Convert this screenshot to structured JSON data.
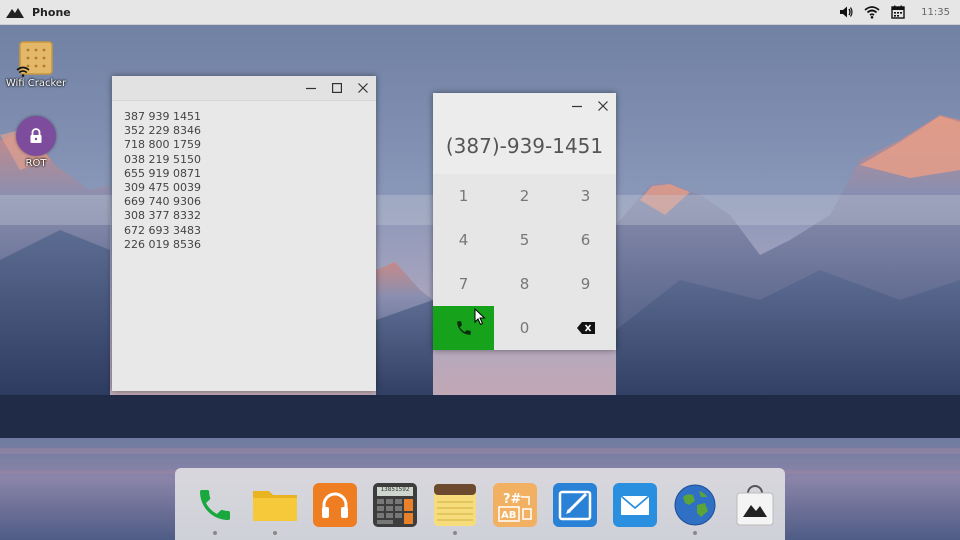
{
  "topbar": {
    "app_title": "Phone",
    "clock": "11:35",
    "tray_icons": [
      "volume-icon",
      "wifi-icon",
      "calendar-icon"
    ]
  },
  "desktop_icons": [
    {
      "label": "Wifi Cracker",
      "icon": "cracker-icon"
    },
    {
      "label": "ROT",
      "icon": "lock-icon"
    }
  ],
  "notes_window": {
    "lines": [
      "387 939 1451",
      "352 229 8346",
      "718 800 1759",
      "038 219 5150",
      "655 919 0871",
      "309 475 0039",
      "669 740 9306",
      "308 377 8332",
      "672 693 3483",
      "226 019 8536"
    ]
  },
  "dialer": {
    "display": "(387)-939-1451",
    "keys": [
      "1",
      "2",
      "3",
      "4",
      "5",
      "6",
      "7",
      "8",
      "9",
      "0"
    ],
    "call_color": "#17a21c"
  },
  "dock": {
    "items": [
      {
        "icon": "phone-icon",
        "running": true
      },
      {
        "icon": "folder-icon",
        "running": true
      },
      {
        "icon": "headphones-icon",
        "running": false
      },
      {
        "icon": "calculator-icon",
        "running": false
      },
      {
        "icon": "notepad-icon",
        "running": true
      },
      {
        "icon": "text-encoder-icon",
        "running": false
      },
      {
        "icon": "drawing-icon",
        "running": false
      },
      {
        "icon": "mail-icon",
        "running": false
      },
      {
        "icon": "globe-icon",
        "running": true
      },
      {
        "icon": "app-store-icon",
        "running": false
      }
    ],
    "calculator_screen": "13851592"
  }
}
